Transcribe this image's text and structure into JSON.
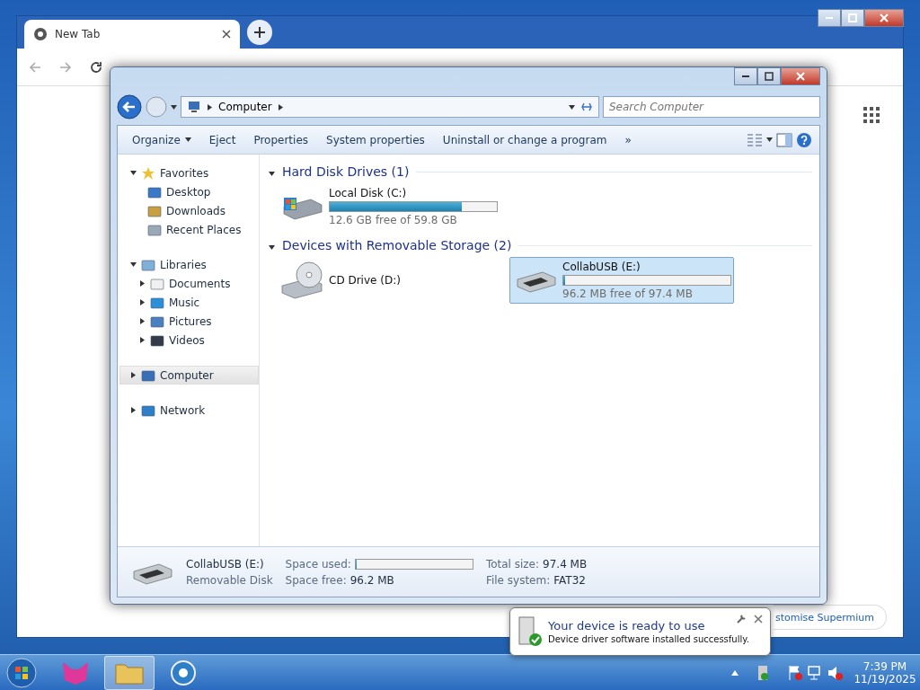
{
  "browser": {
    "tabs": [
      {
        "title": "New Tab",
        "selected": true
      }
    ],
    "customise_button": "stomise Supermium"
  },
  "explorer": {
    "address": {
      "crumbs": [
        "Computer"
      ]
    },
    "search": {
      "placeholder": "Search Computer"
    },
    "toolbar": [
      {
        "label": "Organize",
        "kind": "menu"
      },
      {
        "label": "Eject",
        "kind": "button"
      },
      {
        "label": "Properties",
        "kind": "button"
      },
      {
        "label": "System properties",
        "kind": "button"
      },
      {
        "label": "Uninstall or change a program",
        "kind": "button"
      },
      {
        "label": "»",
        "kind": "button"
      }
    ],
    "sidebar": [
      {
        "label": "Favorites",
        "expanded": true,
        "selected": false,
        "children": [
          {
            "label": "Desktop",
            "selected": false
          },
          {
            "label": "Downloads",
            "selected": false
          },
          {
            "label": "Recent Places",
            "selected": false
          }
        ]
      },
      {
        "label": "Libraries",
        "expanded": true,
        "selected": false,
        "children": [
          {
            "label": "Documents",
            "selected": false,
            "expanded": false
          },
          {
            "label": "Music",
            "selected": false,
            "expanded": false
          },
          {
            "label": "Pictures",
            "selected": false,
            "expanded": false
          },
          {
            "label": "Videos",
            "selected": false,
            "expanded": false
          }
        ]
      },
      {
        "label": "Computer",
        "expanded": false,
        "selected": true
      },
      {
        "label": "Network",
        "expanded": false,
        "selected": false
      }
    ],
    "groups": [
      {
        "title": "Hard Disk Drives (1)",
        "expanded": true,
        "items": [
          {
            "name": "Local Disk (C:)",
            "kind": "disk",
            "level": 0.79,
            "info": "12.6 GB free of 59.8 GB",
            "selected": false
          }
        ]
      },
      {
        "title": "Devices with Removable Storage (2)",
        "expanded": true,
        "items": [
          {
            "name": "CD Drive (D:)",
            "kind": "cd",
            "selected": false
          },
          {
            "name": "CollabUSB (E:)",
            "kind": "usb",
            "level": 0.012,
            "info": "96.2 MB free of 97.4 MB",
            "selected": true
          }
        ]
      }
    ],
    "details": {
      "name": "CollabUSB (E:)",
      "type": "Removable Disk",
      "used": {
        "label": "Space used:",
        "level": 0.012
      },
      "free_label": "Space free:",
      "free": "96.2 MB",
      "total_label": "Total size:",
      "total": "97.4 MB",
      "fs_label": "File system:",
      "fs": "FAT32"
    }
  },
  "notification": {
    "title": "Your device is ready to use",
    "body": "Device driver software installed successfully."
  },
  "taskbar": {
    "apps": [
      {
        "selected": false
      },
      {
        "selected": true
      },
      {
        "selected": false
      }
    ],
    "time": "7:39 PM",
    "date": "11/19/2025"
  }
}
